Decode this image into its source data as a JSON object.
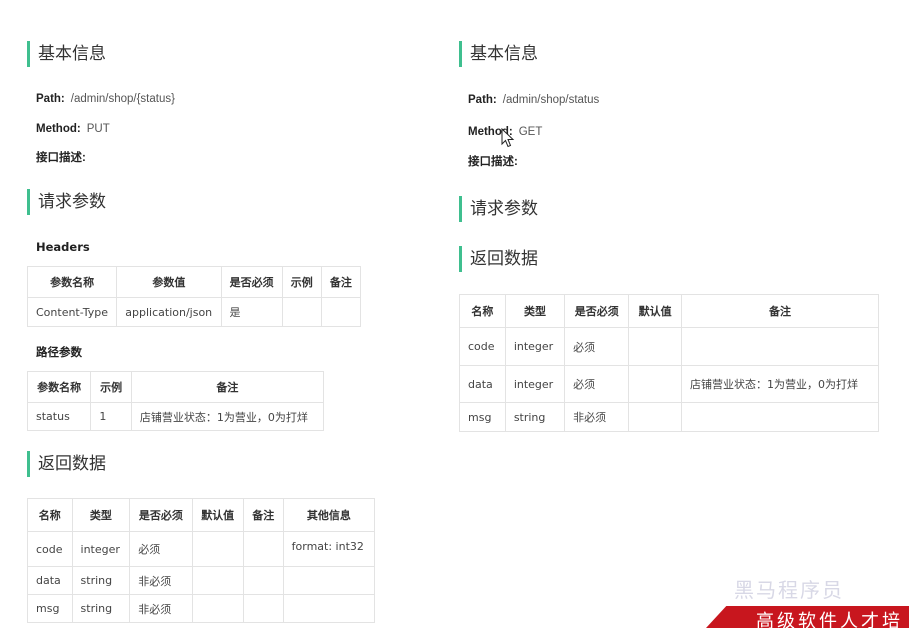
{
  "left": {
    "basic_title": "基本信息",
    "path_label": "Path:",
    "path_value": "/admin/shop/{status}",
    "method_label": "Method:",
    "method_value": "PUT",
    "desc_label": "接口描述:",
    "request_title": "请求参数",
    "headers_label": "Headers",
    "headers_table": {
      "columns": [
        "参数名称",
        "参数值",
        "是否必须",
        "示例",
        "备注"
      ],
      "rows": [
        [
          "Content-Type",
          "application/json",
          "是",
          "",
          ""
        ]
      ]
    },
    "path_params_label": "路径参数",
    "path_params_table": {
      "columns": [
        "参数名称",
        "示例",
        "备注"
      ],
      "rows": [
        [
          "status",
          "1",
          "店铺营业状态：1为营业，0为打烊"
        ]
      ]
    },
    "response_title": "返回数据",
    "response_table": {
      "columns": [
        "名称",
        "类型",
        "是否必须",
        "默认值",
        "备注",
        "其他信息"
      ],
      "rows": [
        [
          "code",
          "integer",
          "必须",
          "",
          "",
          "format: int32"
        ],
        [
          "data",
          "string",
          "非必须",
          "",
          "",
          ""
        ],
        [
          "msg",
          "string",
          "非必须",
          "",
          "",
          ""
        ]
      ]
    }
  },
  "right": {
    "basic_title": "基本信息",
    "path_label": "Path:",
    "path_value": "/admin/shop/status",
    "method_label": "Method:",
    "method_value": "GET",
    "desc_label": "接口描述:",
    "request_title": "请求参数",
    "response_title": "返回数据",
    "response_table": {
      "columns": [
        "名称",
        "类型",
        "是否必须",
        "默认值",
        "备注"
      ],
      "rows": [
        [
          "code",
          "integer",
          "必须",
          "",
          ""
        ],
        [
          "data",
          "integer",
          "必须",
          "",
          "店铺营业状态：1为营业，0为打烊"
        ],
        [
          "msg",
          "string",
          "非必须",
          "",
          ""
        ]
      ]
    }
  },
  "watermark": {
    "upper_text": "黑马程序员",
    "lower_text": "高级软件人才培"
  },
  "colors": {
    "section_accent": "#3fbf8f",
    "table_border": "#e3e3e3",
    "watermark_band": "#c8161e"
  }
}
